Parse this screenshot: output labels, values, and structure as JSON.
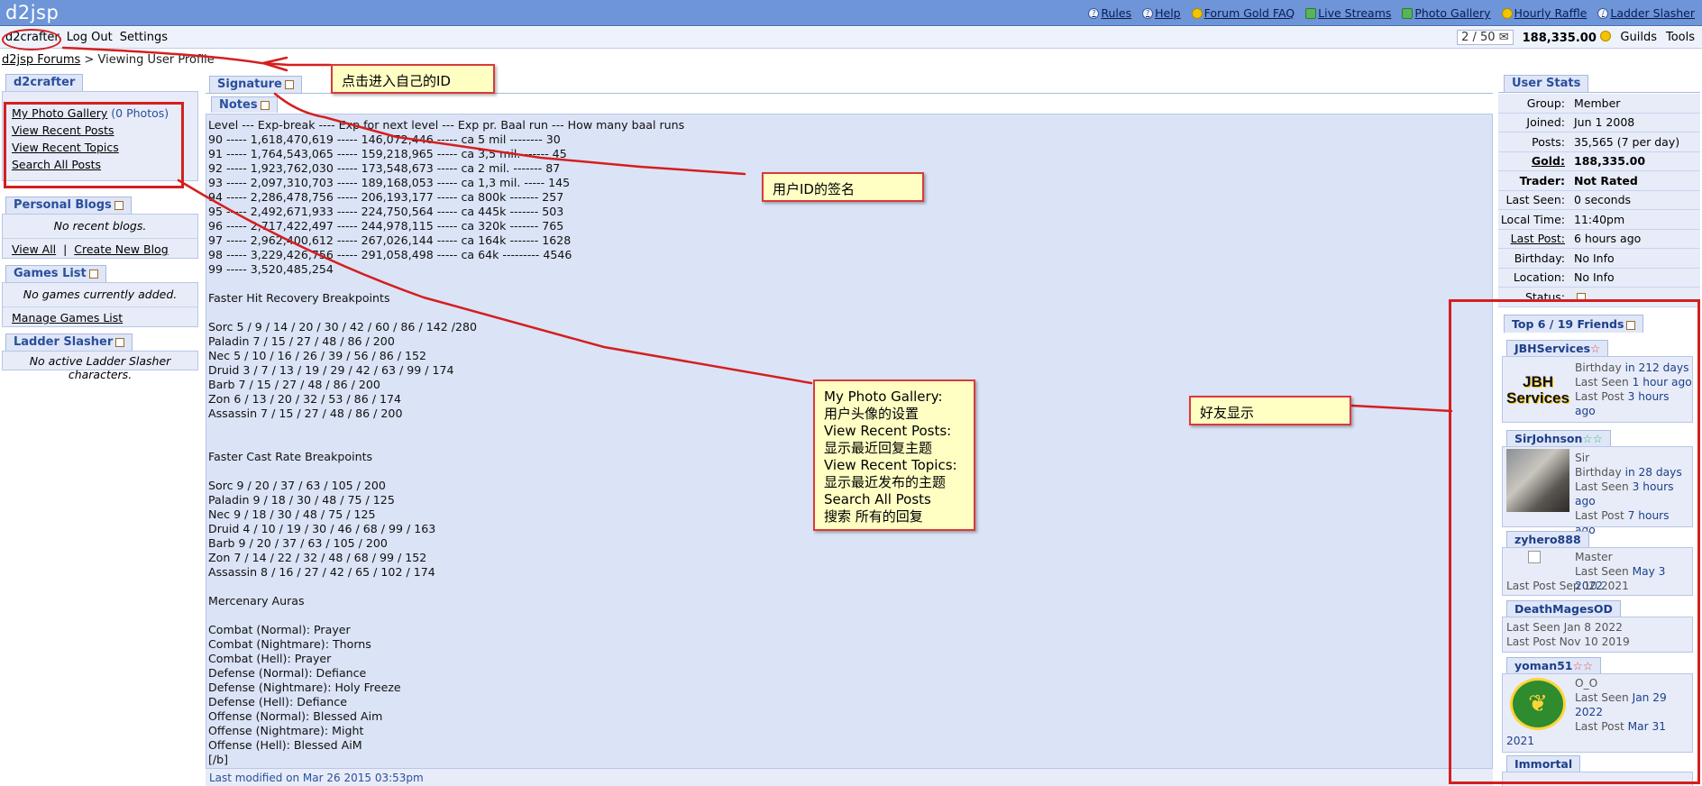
{
  "site": {
    "logo": "d2jsp",
    "top_links": [
      {
        "label": "Rules",
        "icon": "help-circle-icon"
      },
      {
        "label": "Help",
        "icon": "help-circle-icon"
      },
      {
        "label": "Forum Gold FAQ",
        "icon": "gold-coin-icon"
      },
      {
        "label": "Live Streams",
        "icon": "stream-icon"
      },
      {
        "label": "Photo Gallery",
        "icon": "photo-icon"
      },
      {
        "label": "Hourly Raffle",
        "icon": "raffle-icon"
      },
      {
        "label": "Ladder Slasher",
        "icon": "sword-icon"
      }
    ]
  },
  "userbar": {
    "username": "d2crafter",
    "logout": "Log Out",
    "settings": "Settings",
    "pm_count": "2 / 50",
    "gold": "188,335.00",
    "guilds": "Guilds",
    "tools": "Tools"
  },
  "breadcrumb": {
    "root": "d2jsp Forums",
    "sep": ">",
    "current": "Viewing User Profile"
  },
  "left": {
    "user_tab": "d2crafter",
    "links": {
      "photo_gallery": "My Photo Gallery",
      "photo_count": "(0 Photos)",
      "recent_posts": "View Recent Posts",
      "recent_topics": "View Recent Topics",
      "search_posts": "Search All Posts"
    },
    "blogs_tab": "Personal Blogs",
    "no_blogs": "No recent blogs.",
    "view_all": "View All",
    "create_blog": "Create New Blog",
    "games_tab": "Games List",
    "no_games": "No games currently added.",
    "manage_games": "Manage Games List",
    "ladder_tab": "Ladder Slasher",
    "no_ladder": "No active Ladder Slasher characters."
  },
  "center": {
    "signature_tab": "Signature",
    "notes_tab": "Notes",
    "lines": [
      "Level --- Exp-break ---- Exp for next level --- Exp pr. Baal run --- How many baal runs",
      "90 ----- 1,618,470,619 ----- 146,072,446 ----- ca 5 mil -------- 30",
      "91 ----- 1,764,543,065 ----- 159,218,965 ----- ca 3,5 mil. ------ 45",
      "92 ----- 1,923,762,030 ----- 173,548,673 ----- ca 2 mil. ------- 87",
      "93 ----- 2,097,310,703 ----- 189,168,053 ----- ca 1,3 mil. ----- 145",
      "94 ----- 2,286,478,756 ----- 206,193,177 ----- ca 800k ------- 257",
      "95 ----- 2,492,671,933 ----- 224,750,564 ----- ca 445k ------- 503",
      "96 ----- 2,717,422,497 ----- 244,978,115 ----- ca 320k ------- 765",
      "97 ----- 2,962,400,612 ----- 267,026,144 ----- ca 164k ------- 1628",
      "98 ----- 3,229,426,756 ----- 291,058,498 ----- ca 64k --------- 4546",
      "99 ----- 3,520,485,254",
      "",
      "Faster Hit Recovery Breakpoints",
      "",
      "Sorc 5 / 9 / 14 / 20 / 30 / 42 / 60 / 86 / 142 /280",
      "Paladin 7 / 15 / 27 / 48 / 86 / 200",
      "Nec 5 / 10 / 16 / 26 / 39 / 56 / 86 / 152",
      "Druid 3 / 7 / 13 / 19 / 29 / 42 / 63 / 99 / 174",
      "Barb 7 / 15 / 27 / 48 / 86 / 200",
      "Zon 6 / 13 / 20 / 32 / 53 / 86 / 174",
      "Assassin 7 / 15 / 27 / 48 / 86 / 200",
      "",
      "",
      "Faster Cast Rate Breakpoints",
      "",
      "Sorc 9 / 20 / 37 / 63 / 105 / 200",
      "Paladin 9 / 18 / 30 / 48 / 75 / 125",
      "Nec 9 / 18 / 30 / 48 / 75 / 125",
      "Druid 4 / 10 / 19 / 30 / 46 / 68 / 99 / 163",
      "Barb 9 / 20 / 37 / 63 / 105 / 200",
      "Zon 7 / 14 / 22 / 32 / 48 / 68 / 99 / 152",
      "Assassin 8 / 16 / 27 / 42 / 65 / 102 / 174",
      "",
      "Mercenary Auras",
      "",
      "Combat (Normal): Prayer",
      "Combat (Nightmare): Thorns",
      "Combat (Hell): Prayer",
      "Defense (Normal): Defiance",
      "Defense (Nightmare): Holy Freeze",
      "Defense (Hell): Defiance",
      "Offense (Normal): Blessed Aim",
      "Offense (Nightmare): Might",
      "Offense (Hell): Blessed AiM",
      "[/b]"
    ],
    "last_modified": "Last modified on Mar 26 2015 03:53pm"
  },
  "stats": {
    "tab": "User Stats",
    "rows": [
      {
        "k": "Group:",
        "v": "Member"
      },
      {
        "k": "Joined:",
        "v": "Jun 1 2008"
      },
      {
        "k": "Posts:",
        "v": "35,565 (7 per day)"
      },
      {
        "k": "Gold:",
        "v": "188,335.00"
      },
      {
        "k": "Trader:",
        "v": "Not Rated"
      },
      {
        "k": "Last Seen:",
        "v": "0 seconds"
      },
      {
        "k": "Local Time:",
        "v": "11:40pm"
      },
      {
        "k": "Last Post:",
        "v": "6 hours ago"
      },
      {
        "k": "Birthday:",
        "v": "No Info"
      },
      {
        "k": "Location:",
        "v": "No Info"
      },
      {
        "k": "Status:",
        "v": ""
      }
    ]
  },
  "friends": {
    "tab": "Top 6 / 19 Friends",
    "f1": {
      "name": "JBHServices",
      "avatar_text": "JBH Services",
      "birthday_l": "Birthday",
      "birthday_v": "in 212 days",
      "seen_l": "Last Seen",
      "seen_v": "1 hour ago",
      "post_l": "Last Post",
      "post_v": "3 hours ago"
    },
    "f2": {
      "name": "SirJohnson",
      "title": "Sir",
      "birthday_l": "Birthday",
      "birthday_v": "in 28 days",
      "seen_l": "Last Seen",
      "seen_v": "3 hours",
      "seen_v2": "ago",
      "post_l": "Last Post",
      "post_v": "7 hours ago"
    },
    "f3": {
      "name": "zyhero888",
      "title": "Master",
      "seen_l": "Last Seen",
      "seen_v": "May 3 2022",
      "post_l": "Last Post",
      "post_v": "Sep 10 2021"
    },
    "f4": {
      "name": "DeathMagesOD",
      "seen_l": "Last Seen",
      "seen_v": "Jan 8 2022",
      "post_l": "Last Post",
      "post_v": "Nov 10 2019"
    },
    "f5": {
      "name": "yoman51",
      "title": "O_O",
      "seen_l": "Last Seen",
      "seen_v": "Jan 29",
      "seen_v2": "2022",
      "post_l": "Last Post",
      "post_v": "Mar 31",
      "post_v2": "2021"
    },
    "f6": {
      "name": "Immortal"
    }
  },
  "annotations": {
    "enter_id": "点击进入自己的ID",
    "signature": "用户ID的签名",
    "menu_help": [
      "My Photo Gallery:",
      "用户头像的设置",
      "View Recent Posts:",
      "显示最近回复主题",
      "View Recent Topics:",
      "显示最近发布的主题",
      "Search All Posts",
      "搜索 所有的回复"
    ],
    "friends": "好友显示"
  },
  "colors": {
    "topbar": "#6d95d8",
    "annotation_red": "#d41f1f",
    "note_yellow": "#ffffc4",
    "link_blue": "#2a4f9c"
  }
}
